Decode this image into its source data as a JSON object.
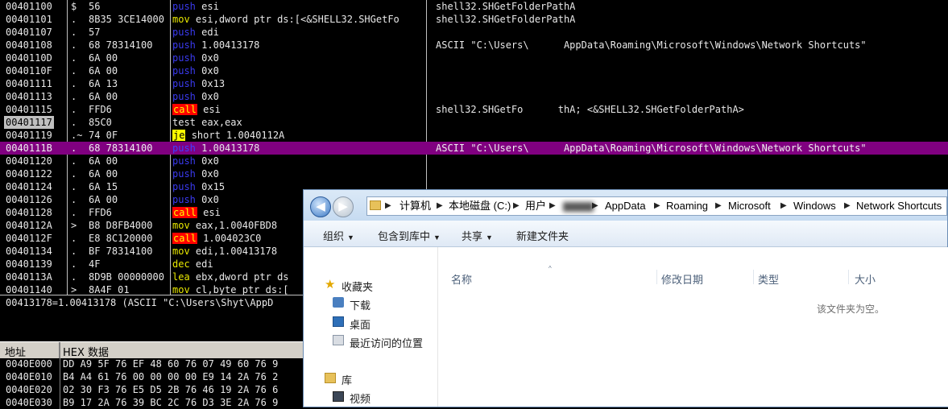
{
  "disasm": [
    {
      "addr": "00401100",
      "mark": "$",
      "hex": "56",
      "op": "push",
      "opclass": "push",
      "args": "esi",
      "comment": "shell32.SHGetFolderPathA"
    },
    {
      "addr": "00401101",
      "mark": ".",
      "hex": "8B35 3CE14000",
      "op": "mov",
      "opclass": "mov",
      "args": "esi,dword ptr ds:[<&SHELL32.SHGetFo",
      "comment": "shell32.SHGetFolderPathA"
    },
    {
      "addr": "00401107",
      "mark": ".",
      "hex": "57",
      "op": "push",
      "opclass": "push",
      "args": "edi",
      "comment": ""
    },
    {
      "addr": "00401108",
      "mark": ".",
      "hex": "68 78314100",
      "op": "push",
      "opclass": "push",
      "args": "1.00413178",
      "comment": "ASCII \"C:\\Users\\      AppData\\Roaming\\Microsoft\\Windows\\Network Shortcuts\""
    },
    {
      "addr": "0040110D",
      "mark": ".",
      "hex": "6A 00",
      "op": "push",
      "opclass": "push",
      "args": "0x0",
      "comment": ""
    },
    {
      "addr": "0040110F",
      "mark": ".",
      "hex": "6A 00",
      "op": "push",
      "opclass": "push",
      "args": "0x0",
      "comment": ""
    },
    {
      "addr": "00401111",
      "mark": ".",
      "hex": "6A 13",
      "op": "push",
      "opclass": "push",
      "args": "0x13",
      "comment": ""
    },
    {
      "addr": "00401113",
      "mark": ".",
      "hex": "6A 00",
      "op": "push",
      "opclass": "push",
      "args": "0x0",
      "comment": ""
    },
    {
      "addr": "00401115",
      "mark": ".",
      "hex": "FFD6",
      "op": "call",
      "opclass": "call",
      "args": "esi",
      "comment": "shell32.SHGetFo      thA; <&SHELL32.SHGetFolderPathA>"
    },
    {
      "addr": "00401117",
      "mark": ".",
      "hex": "85C0",
      "op": "test",
      "opclass": "plain",
      "args": "eax,eax",
      "comment": ""
    },
    {
      "addr": "00401119",
      "mark": ".~",
      "hex": "74 0F",
      "op": "je",
      "opclass": "jmp",
      "args": "short 1.0040112A",
      "comment": ""
    },
    {
      "addr": "0040111B",
      "mark": ".",
      "hex": "68 78314100",
      "op": "push",
      "opclass": "push",
      "args": "1.00413178",
      "comment": "ASCII \"C:\\Users\\      AppData\\Roaming\\Microsoft\\Windows\\Network Shortcuts\""
    },
    {
      "addr": "00401120",
      "mark": ".",
      "hex": "6A 00",
      "op": "push",
      "opclass": "push",
      "args": "0x0",
      "comment": ""
    },
    {
      "addr": "00401122",
      "mark": ".",
      "hex": "6A 00",
      "op": "push",
      "opclass": "push",
      "args": "0x0",
      "comment": ""
    },
    {
      "addr": "00401124",
      "mark": ".",
      "hex": "6A 15",
      "op": "push",
      "opclass": "push",
      "args": "0x15",
      "comment": ""
    },
    {
      "addr": "00401126",
      "mark": ".",
      "hex": "6A 00",
      "op": "push",
      "opclass": "push",
      "args": "0x0",
      "comment": ""
    },
    {
      "addr": "00401128",
      "mark": ".",
      "hex": "FFD6",
      "op": "call",
      "opclass": "call",
      "args": "esi",
      "comment": ""
    },
    {
      "addr": "0040112A",
      "mark": ">",
      "hex": "B8 D8FB4000",
      "op": "mov",
      "opclass": "mov",
      "args": "eax,1.0040FBD8",
      "comment": ""
    },
    {
      "addr": "0040112F",
      "mark": ".",
      "hex": "E8 8C120000",
      "op": "call",
      "opclass": "call",
      "args": "1.004023C0",
      "comment": ""
    },
    {
      "addr": "00401134",
      "mark": ".",
      "hex": "BF 78314100",
      "op": "mov",
      "opclass": "mov",
      "args": "edi,1.00413178",
      "comment": ""
    },
    {
      "addr": "00401139",
      "mark": ".",
      "hex": "4F",
      "op": "dec",
      "opclass": "mov",
      "args": "edi",
      "comment": ""
    },
    {
      "addr": "0040113A",
      "mark": ".",
      "hex": "8D9B 00000000",
      "op": "lea",
      "opclass": "mov",
      "args": "ebx,dword ptr ds",
      "comment": ""
    },
    {
      "addr": "00401140",
      "mark": ">",
      "hex": "8A4F 01",
      "op": "mov",
      "opclass": "mov",
      "args": "cl,byte ptr ds:[",
      "comment": ""
    }
  ],
  "info_line": "00413178=1.00413178 (ASCII \"C:\\Users\\Shyt\\AppD",
  "dump": {
    "col_addr": "地址",
    "col_hex": "HEX 数据",
    "rows": [
      {
        "addr": "0040E000",
        "hex": "DD A9 5F 76 EF 48 60 76 07 49 60 76 9"
      },
      {
        "addr": "0040E010",
        "hex": "B4 A4 61 76 00 00 00 00 E9 14 2A 76 2"
      },
      {
        "addr": "0040E020",
        "hex": "02 30 F3 76 E5 D5 2B 76 46 19 2A 76 6"
      },
      {
        "addr": "0040E030",
        "hex": "B9 17 2A 76 39 BC 2C 76 D3 3E 2A 76 9"
      }
    ]
  },
  "explorer": {
    "breadcrumbs": [
      "计算机",
      "本地磁盘 (C:)",
      "用户",
      "AppData",
      "Roaming",
      "Microsoft",
      "Windows",
      "Network Shortcuts"
    ],
    "toolbar": {
      "organize": "组织",
      "include": "包含到库中",
      "share": "共享",
      "new_folder": "新建文件夹"
    },
    "nav": {
      "favorites": "收藏夹",
      "downloads": "下载",
      "desktop": "桌面",
      "recent": "最近访问的位置",
      "libraries": "库",
      "videos": "视频"
    },
    "columns": {
      "name": "名称",
      "modified": "修改日期",
      "type": "类型",
      "size": "大小"
    },
    "empty_text": "该文件夹为空。"
  },
  "colors": {
    "highlight": "#800080",
    "push": "#3a3af0",
    "mov": "#e8e800",
    "call_bg": "#ff0000",
    "jump_bg": "#ffff00"
  }
}
